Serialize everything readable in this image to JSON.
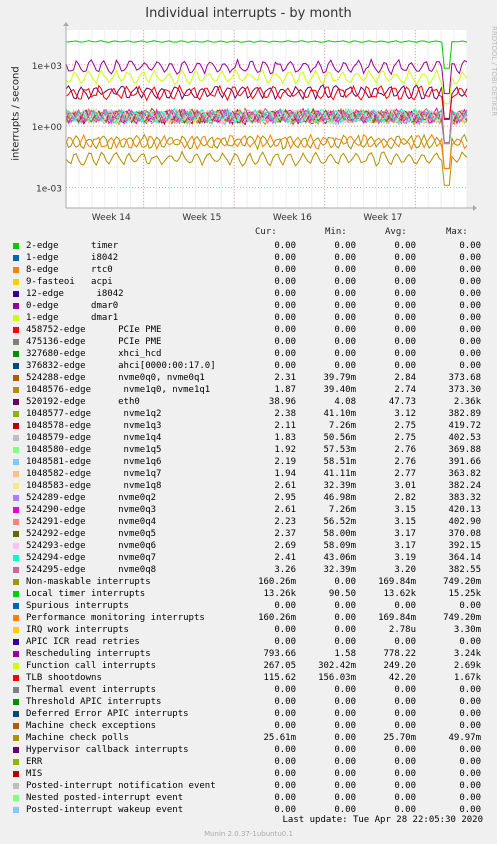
{
  "chart_data": {
    "type": "line",
    "title": "Individual interrupts - by month",
    "ylabel": "interrupts / second",
    "yscale": "log",
    "ylim": [
      0.0001,
      50000
    ],
    "yticks": [
      "1e+03",
      "1e+00",
      "1e-03"
    ],
    "x_tick_labels": [
      "Week 14",
      "Week 15",
      "Week 16",
      "Week 17"
    ],
    "watermark": "RRDTOOL / TOBI OETIKER",
    "columns": [
      "Cur:",
      "Min:",
      "Avg:",
      "Max:"
    ],
    "series": [
      {
        "name": "2-edge      timer",
        "color": "#00cc00",
        "values": [
          "0.00",
          "0.00",
          "0.00",
          "0.00"
        ]
      },
      {
        "name": "1-edge      i8042",
        "color": "#0066b3",
        "values": [
          "0.00",
          "0.00",
          "0.00",
          "0.00"
        ]
      },
      {
        "name": "8-edge      rtc0",
        "color": "#ff8000",
        "values": [
          "0.00",
          "0.00",
          "0.00",
          "0.00"
        ]
      },
      {
        "name": "9-fasteoi   acpi",
        "color": "#ffcc00",
        "values": [
          "0.00",
          "0.00",
          "0.00",
          "0.00"
        ]
      },
      {
        "name": "12-edge      i8042",
        "color": "#330099",
        "values": [
          "0.00",
          "0.00",
          "0.00",
          "0.00"
        ]
      },
      {
        "name": "0-edge      dmar0",
        "color": "#990099",
        "values": [
          "0.00",
          "0.00",
          "0.00",
          "0.00"
        ]
      },
      {
        "name": "1-edge      dmar1",
        "color": "#ccff00",
        "values": [
          "0.00",
          "0.00",
          "0.00",
          "0.00"
        ]
      },
      {
        "name": "458752-edge      PCIe PME",
        "color": "#ff0000",
        "values": [
          "0.00",
          "0.00",
          "0.00",
          "0.00"
        ]
      },
      {
        "name": "475136-edge      PCIe PME",
        "color": "#808080",
        "values": [
          "0.00",
          "0.00",
          "0.00",
          "0.00"
        ]
      },
      {
        "name": "327680-edge      xhci_hcd",
        "color": "#008f00",
        "values": [
          "0.00",
          "0.00",
          "0.00",
          "0.00"
        ]
      },
      {
        "name": "376832-edge      ahci[0000:00:17.0]",
        "color": "#00487d",
        "values": [
          "0.00",
          "0.00",
          "0.00",
          "0.00"
        ]
      },
      {
        "name": "524288-edge      nvme0q0, nvme0q1",
        "color": "#b35a00",
        "values": [
          "2.31",
          "39.79m",
          "2.84",
          "373.68"
        ]
      },
      {
        "name": "1048576-edge      nvme1q0, nvme1q1",
        "color": "#b38f00",
        "values": [
          "1.87",
          "39.40m",
          "2.74",
          "373.30"
        ]
      },
      {
        "name": "520192-edge      eth0",
        "color": "#6b006b",
        "values": [
          "38.96",
          "4.08",
          "47.73",
          "2.36k"
        ]
      },
      {
        "name": "1048577-edge      nvme1q2",
        "color": "#8fb300",
        "values": [
          "2.38",
          "41.10m",
          "3.12",
          "382.89"
        ]
      },
      {
        "name": "1048578-edge      nvme1q3",
        "color": "#b30000",
        "values": [
          "2.11",
          "7.26m",
          "2.75",
          "419.72"
        ]
      },
      {
        "name": "1048579-edge      nvme1q4",
        "color": "#bebebe",
        "values": [
          "1.83",
          "50.56m",
          "2.75",
          "402.53"
        ]
      },
      {
        "name": "1048580-edge      nvme1q5",
        "color": "#80ff80",
        "values": [
          "1.92",
          "57.53m",
          "2.76",
          "369.88"
        ]
      },
      {
        "name": "1048581-edge      nvme1q6",
        "color": "#80c9ff",
        "values": [
          "2.19",
          "58.51m",
          "2.76",
          "391.66"
        ]
      },
      {
        "name": "1048582-edge      nvme1q7",
        "color": "#ffc080",
        "values": [
          "1.94",
          "41.11m",
          "2.77",
          "363.82"
        ]
      },
      {
        "name": "1048583-edge      nvme1q8",
        "color": "#ffe680",
        "values": [
          "2.61",
          "32.39m",
          "3.01",
          "382.24"
        ]
      },
      {
        "name": "524289-edge      nvme0q2",
        "color": "#aa80ff",
        "values": [
          "2.95",
          "46.98m",
          "2.82",
          "383.32"
        ]
      },
      {
        "name": "524290-edge      nvme0q3",
        "color": "#ee00cc",
        "values": [
          "2.61",
          "7.26m",
          "3.15",
          "420.13"
        ]
      },
      {
        "name": "524291-edge      nvme0q4",
        "color": "#ff8080",
        "values": [
          "2.23",
          "56.52m",
          "3.15",
          "402.90"
        ]
      },
      {
        "name": "524292-edge      nvme0q5",
        "color": "#666600",
        "values": [
          "2.37",
          "58.00m",
          "3.17",
          "370.08"
        ]
      },
      {
        "name": "524293-edge      nvme0q6",
        "color": "#ffbfff",
        "values": [
          "2.69",
          "58.09m",
          "3.17",
          "392.15"
        ]
      },
      {
        "name": "524294-edge      nvme0q7",
        "color": "#00ffcc",
        "values": [
          "2.41",
          "43.06m",
          "3.19",
          "364.14"
        ]
      },
      {
        "name": "524295-edge      nvme0q8",
        "color": "#cc6699",
        "values": [
          "3.26",
          "32.39m",
          "3.20",
          "382.55"
        ]
      },
      {
        "name": "Non-maskable interrupts",
        "color": "#999900",
        "values": [
          "160.26m",
          "0.00",
          "169.84m",
          "749.20m"
        ]
      },
      {
        "name": "Local timer interrupts",
        "color": "#00cc00",
        "values": [
          "13.26k",
          "90.50",
          "13.62k",
          "15.25k"
        ]
      },
      {
        "name": "Spurious interrupts",
        "color": "#0066b3",
        "values": [
          "0.00",
          "0.00",
          "0.00",
          "0.00"
        ]
      },
      {
        "name": "Performance monitoring interrupts",
        "color": "#ff8000",
        "values": [
          "160.26m",
          "0.00",
          "169.84m",
          "749.20m"
        ]
      },
      {
        "name": "IRQ work interrupts",
        "color": "#ffcc00",
        "values": [
          "0.00",
          "0.00",
          "2.78u",
          "3.30m"
        ]
      },
      {
        "name": "APIC ICR read retries",
        "color": "#330099",
        "values": [
          "0.00",
          "0.00",
          "0.00",
          "0.00"
        ]
      },
      {
        "name": "Rescheduling interrupts",
        "color": "#990099",
        "values": [
          "793.66",
          "1.58",
          "778.22",
          "3.24k"
        ]
      },
      {
        "name": "Function call interrupts",
        "color": "#ccff00",
        "values": [
          "267.05",
          "302.42m",
          "249.20",
          "2.69k"
        ]
      },
      {
        "name": "TLB shootdowns",
        "color": "#ff0000",
        "values": [
          "115.62",
          "156.03m",
          "42.20",
          "1.67k"
        ]
      },
      {
        "name": "Thermal event interrupts",
        "color": "#808080",
        "values": [
          "0.00",
          "0.00",
          "0.00",
          "0.00"
        ]
      },
      {
        "name": "Threshold APIC interrupts",
        "color": "#008f00",
        "values": [
          "0.00",
          "0.00",
          "0.00",
          "0.00"
        ]
      },
      {
        "name": "Deferred Error APIC interrupts",
        "color": "#00487d",
        "values": [
          "0.00",
          "0.00",
          "0.00",
          "0.00"
        ]
      },
      {
        "name": "Machine check exceptions",
        "color": "#b35a00",
        "values": [
          "0.00",
          "0.00",
          "0.00",
          "0.00"
        ]
      },
      {
        "name": "Machine check polls",
        "color": "#b38f00",
        "values": [
          "25.61m",
          "0.00",
          "25.70m",
          "49.97m"
        ]
      },
      {
        "name": "Hypervisor callback interrupts",
        "color": "#6b006b",
        "values": [
          "0.00",
          "0.00",
          "0.00",
          "0.00"
        ]
      },
      {
        "name": "ERR",
        "color": "#8fb300",
        "values": [
          "0.00",
          "0.00",
          "0.00",
          "0.00"
        ]
      },
      {
        "name": "MIS",
        "color": "#b30000",
        "values": [
          "0.00",
          "0.00",
          "0.00",
          "0.00"
        ]
      },
      {
        "name": "Posted-interrupt notification event",
        "color": "#bebebe",
        "values": [
          "0.00",
          "0.00",
          "0.00",
          "0.00"
        ]
      },
      {
        "name": "Nested posted-interrupt event",
        "color": "#80ff80",
        "values": [
          "0.00",
          "0.00",
          "0.00",
          "0.00"
        ]
      },
      {
        "name": "Posted-interrupt wakeup event",
        "color": "#80c9ff",
        "values": [
          "0.00",
          "0.00",
          "0.00",
          "0.00"
        ]
      }
    ]
  },
  "last_update": "Last update: Tue Apr 28 22:05:30 2020",
  "footer": "Munin 2.0.37-1ubuntu0.1"
}
